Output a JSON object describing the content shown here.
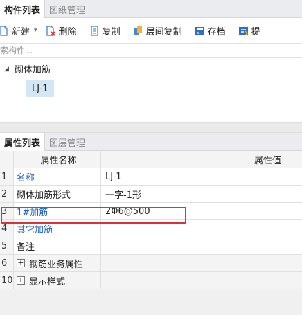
{
  "top_tabs": [
    "构件列表",
    "图纸管理"
  ],
  "toolbar": {
    "new_label": "新建",
    "delete_label": "删除",
    "copy_label": "复制",
    "layer_copy_label": "层间复制",
    "archive_label": "存档",
    "extract_label": "提"
  },
  "search": {
    "placeholder": "搜索构件..."
  },
  "tree": {
    "parent_label": "砌体加筋",
    "child_label": "LJ-1"
  },
  "prop_tabs": [
    "属性列表",
    "图层管理"
  ],
  "grid": {
    "header_name": "属性名称",
    "header_value": "属性值",
    "rows": [
      {
        "idx": "1",
        "name": "名称",
        "value": "LJ-1"
      },
      {
        "idx": "2",
        "name": "砌体加筋形式",
        "value": "一字-1形"
      },
      {
        "idx": "3",
        "name": "1#加筋",
        "value": "2Φ6@500"
      },
      {
        "idx": "4",
        "name": "其它加筋",
        "value": ""
      },
      {
        "idx": "5",
        "name": "备注",
        "value": ""
      },
      {
        "idx": "6",
        "name": "钢筋业务属性",
        "value": ""
      },
      {
        "idx": "10",
        "name": "显示样式",
        "value": ""
      }
    ]
  },
  "colors": {
    "link_blue": "#1f5fd1",
    "highlight_red": "#e0303a",
    "selection": "#d5e7f7"
  }
}
